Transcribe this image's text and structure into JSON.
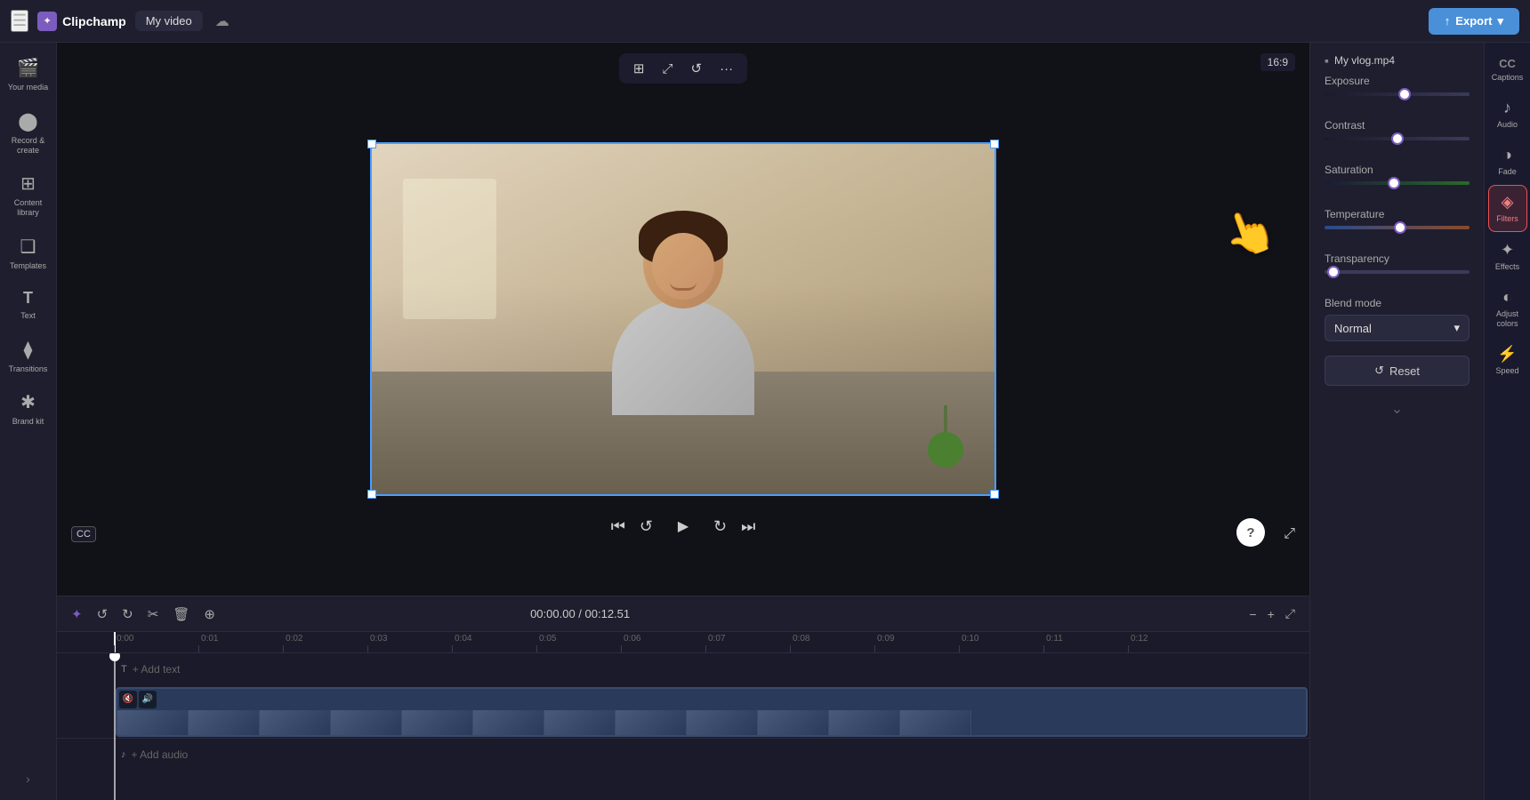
{
  "topbar": {
    "menu_icon": "☰",
    "logo_icon": "✦",
    "logo_text": "Clipchamp",
    "tab_title": "My video",
    "cloud_icon": "☁",
    "export_label": "Export",
    "export_icon": "↑"
  },
  "left_sidebar": {
    "items": [
      {
        "id": "your-media",
        "icon": "⬛",
        "label": "Your media"
      },
      {
        "id": "record-create",
        "icon": "⬤",
        "label": "Record & create"
      },
      {
        "id": "content-library",
        "icon": "⊞",
        "label": "Content library"
      },
      {
        "id": "templates",
        "icon": "❑",
        "label": "Templates"
      },
      {
        "id": "text",
        "icon": "T",
        "label": "Text"
      },
      {
        "id": "transitions",
        "icon": "⧫",
        "label": "Transitions"
      },
      {
        "id": "brand-kit",
        "icon": "✱",
        "label": "Brand kit"
      }
    ]
  },
  "preview": {
    "toolbar": {
      "crop_icon": "⊞",
      "resize_icon": "⤢",
      "rotate_icon": "↺",
      "more_icon": "···"
    },
    "aspect_ratio": "16:9",
    "cc_label": "CC",
    "help_label": "?"
  },
  "playback": {
    "skip_start_icon": "⏮",
    "rewind_icon": "↺",
    "play_icon": "▶",
    "fast_forward_icon": "↻",
    "skip_end_icon": "⏭",
    "fullscreen_icon": "⤢",
    "current_time": "00:00.00",
    "total_time": "00:12.51"
  },
  "timeline": {
    "tools": [
      {
        "id": "add",
        "icon": "✦"
      },
      {
        "id": "undo",
        "icon": "↺"
      },
      {
        "id": "redo",
        "icon": "↻"
      },
      {
        "id": "cut",
        "icon": "✂"
      },
      {
        "id": "delete",
        "icon": "🗑"
      },
      {
        "id": "add-to-timeline",
        "icon": "⊕"
      }
    ],
    "time_display": "00:00.00 / 00:12.51",
    "zoom_in_icon": "+",
    "zoom_out_icon": "−",
    "zoom_fit_icon": "⤢",
    "ruler_marks": [
      "0:00",
      "0:01",
      "0:02",
      "0:03",
      "0:04",
      "0:05",
      "0:06",
      "0:07",
      "0:08",
      "0:09",
      "0:10",
      "0:11",
      "0:12"
    ],
    "add_text_label": "+ Add text",
    "add_audio_label": "+ Add audio",
    "track_icon_mute": "🔇",
    "track_icon_sound": "🔊"
  },
  "right_panel": {
    "file_icon": "▪",
    "file_name": "My vlog.mp4",
    "sections": {
      "exposure": {
        "label": "Exposure",
        "value": 55
      },
      "contrast": {
        "label": "Contrast",
        "value": 50
      },
      "saturation": {
        "label": "Saturation",
        "value": 48
      },
      "temperature": {
        "label": "Temperature",
        "value": 52
      },
      "transparency": {
        "label": "Transparency",
        "value": 2
      }
    },
    "blend_mode": {
      "label": "Blend mode",
      "value": "Normal",
      "chevron_icon": "▾"
    },
    "reset_label": "Reset",
    "reset_icon": "↺",
    "collapse_icon": "›"
  },
  "far_right_panel": {
    "items": [
      {
        "id": "captions",
        "icon": "CC",
        "label": "Captions",
        "active": false
      },
      {
        "id": "audio",
        "icon": "♪",
        "label": "Audio",
        "active": false
      },
      {
        "id": "fade",
        "icon": "◑",
        "label": "Fade",
        "active": false
      },
      {
        "id": "filters",
        "icon": "◈",
        "label": "Filters",
        "active": true,
        "highlight": true
      },
      {
        "id": "effects",
        "icon": "✦",
        "label": "Effects",
        "active": false
      },
      {
        "id": "adjust-colors",
        "icon": "◐",
        "label": "Adjust colors",
        "active": false
      },
      {
        "id": "speed",
        "icon": "⚡",
        "label": "Speed",
        "active": false
      }
    ]
  }
}
